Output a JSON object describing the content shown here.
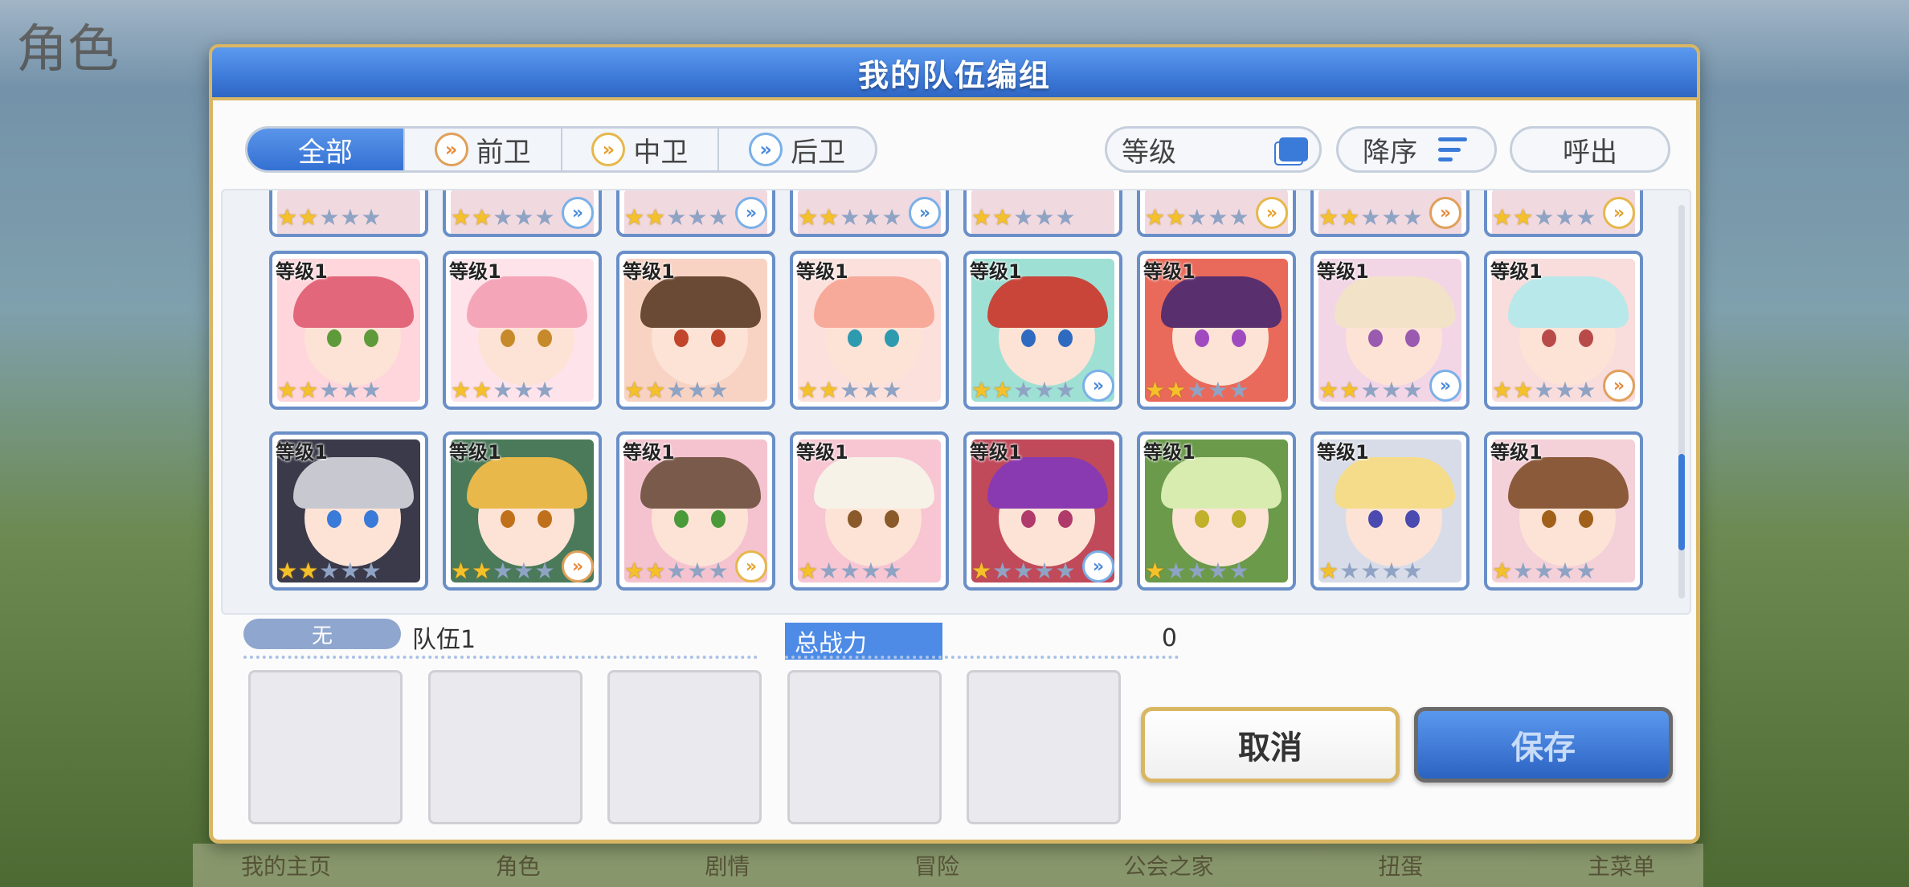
{
  "background": {
    "screen_title": "角色",
    "bottom_nav": [
      "我的主页",
      "角色",
      "剧情",
      "冒险",
      "公会之家",
      "扭蛋",
      "主菜单"
    ]
  },
  "dialog": {
    "title": "我的队伍编组",
    "filters": {
      "all": "全部",
      "front": "前卫",
      "mid": "中卫",
      "back": "后卫"
    },
    "sort_field": "等级",
    "sort_order": "降序",
    "call_out": "呼出"
  },
  "roster": {
    "level_prefix": "等级",
    "top_row_partial": [
      {
        "stars": 2,
        "role": ""
      },
      {
        "stars": 2,
        "role": "back"
      },
      {
        "stars": 2,
        "role": "back"
      },
      {
        "stars": 2,
        "role": "back"
      },
      {
        "stars": 2,
        "role": ""
      },
      {
        "stars": 2,
        "role": "mid"
      },
      {
        "stars": 2,
        "role": "front"
      },
      {
        "stars": 2,
        "role": "mid"
      }
    ],
    "row2": [
      {
        "level": "等级1",
        "stars": 2,
        "role": "",
        "hair": "#e2677a",
        "bg": "#ffd6dc",
        "eye": "#5f9a3a"
      },
      {
        "level": "等级1",
        "stars": 2,
        "role": "",
        "hair": "#f4a6b8",
        "bg": "#ffe3ea",
        "eye": "#c78a2a"
      },
      {
        "level": "等级1",
        "stars": 2,
        "role": "",
        "hair": "#6b4a35",
        "bg": "#f8d3c4",
        "eye": "#c0452a"
      },
      {
        "level": "等级1",
        "stars": 2,
        "role": "",
        "hair": "#f7a99a",
        "bg": "#fce0dc",
        "eye": "#2e9ab0"
      },
      {
        "level": "等级1",
        "stars": 2,
        "role": "back",
        "hair": "#c9453a",
        "bg": "#9fe0d4",
        "eye": "#2e6ac0"
      },
      {
        "level": "等级1",
        "stars": 2,
        "role": "",
        "hair": "#5a2f6e",
        "bg": "#e96a5a",
        "eye": "#a04ac0"
      },
      {
        "level": "等级1",
        "stars": 2,
        "role": "back",
        "hair": "#f2e2c8",
        "bg": "#f3d6e6",
        "eye": "#9a5ab0"
      },
      {
        "level": "等级1",
        "stars": 2,
        "role": "front",
        "hair": "#b8e8ea",
        "bg": "#f9dcdc",
        "eye": "#b84a4a"
      }
    ],
    "row3": [
      {
        "level": "等级1",
        "stars": 2,
        "role": "",
        "hair": "#c8c8d0",
        "bg": "#3a3a4a",
        "eye": "#3a7ad8"
      },
      {
        "level": "等级1",
        "stars": 2,
        "role": "front",
        "hair": "#e8b84a",
        "bg": "#4a7a5a",
        "eye": "#c0701a"
      },
      {
        "level": "等级1",
        "stars": 2,
        "role": "mid",
        "hair": "#7a5a4a",
        "bg": "#f4c3cf",
        "eye": "#4a9a3a"
      },
      {
        "level": "等级1",
        "stars": 1,
        "role": "",
        "hair": "#f7f2e8",
        "bg": "#f7c6d2",
        "eye": "#8a5a2a"
      },
      {
        "level": "等级1",
        "stars": 1,
        "role": "back",
        "hair": "#8a3ab0",
        "bg": "#c04a5a",
        "eye": "#b03a6a"
      },
      {
        "level": "等级1",
        "stars": 1,
        "role": "",
        "hair": "#d8ecb0",
        "bg": "#6a9a4a",
        "eye": "#c0b02a"
      },
      {
        "level": "等级1",
        "stars": 1,
        "role": "",
        "hair": "#f5dc8a",
        "bg": "#d8dce8",
        "eye": "#4a4ab0"
      },
      {
        "level": "等级1",
        "stars": 1,
        "role": "",
        "hair": "#8a5a3a",
        "bg": "#f4d0d8",
        "eye": "#a0601a"
      }
    ]
  },
  "team": {
    "label": "无",
    "name": "队伍1",
    "power_label": "总战力",
    "power_value": "0",
    "slots": 5
  },
  "buttons": {
    "cancel": "取消",
    "save": "保存"
  }
}
